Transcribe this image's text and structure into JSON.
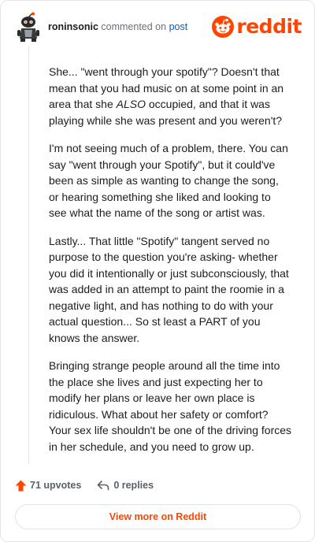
{
  "comment": {
    "author": "roninsonic",
    "action": "commented on",
    "link_text": "post",
    "paragraphs": [
      {
        "before": "She... \"went through your spotify\"? Doesn't that mean that you had music on at some point in an area that she ",
        "italic": "ALSO",
        "after": " occupied, and that it was playing while she was present and you weren't?"
      },
      {
        "text": "I'm not seeing much of a problem, there. You can say \"went through your Spotify\", but it could've been as simple as wanting to change the song, or hearing something she liked and looking to see what the name of the song or artist was."
      },
      {
        "text": "Lastly... That little \"Spotify\" tangent served no purpose to the question you're asking- whether you did it intentionally or just subconsciously, that was added in an attempt to paint the roomie in a negative light, and has nothing to do with your actual question... So st least a PART of you knows the answer."
      },
      {
        "text": "Bringing strange people around all the time into the place she lives and just expecting her to modify her plans or leave her own place is ridiculous. What about her safety or comfort? Your sex life shouldn't be one of the driving forces in her schedule, and you need to grow up."
      }
    ]
  },
  "brand": {
    "name": "reddit",
    "color": "#ff4500"
  },
  "footer": {
    "upvotes": "71 upvotes",
    "replies": "0 replies",
    "upvote_icon": "upvote-arrow-icon",
    "reply_icon": "reply-arrow-icon"
  },
  "view_more_label": "View more on Reddit"
}
